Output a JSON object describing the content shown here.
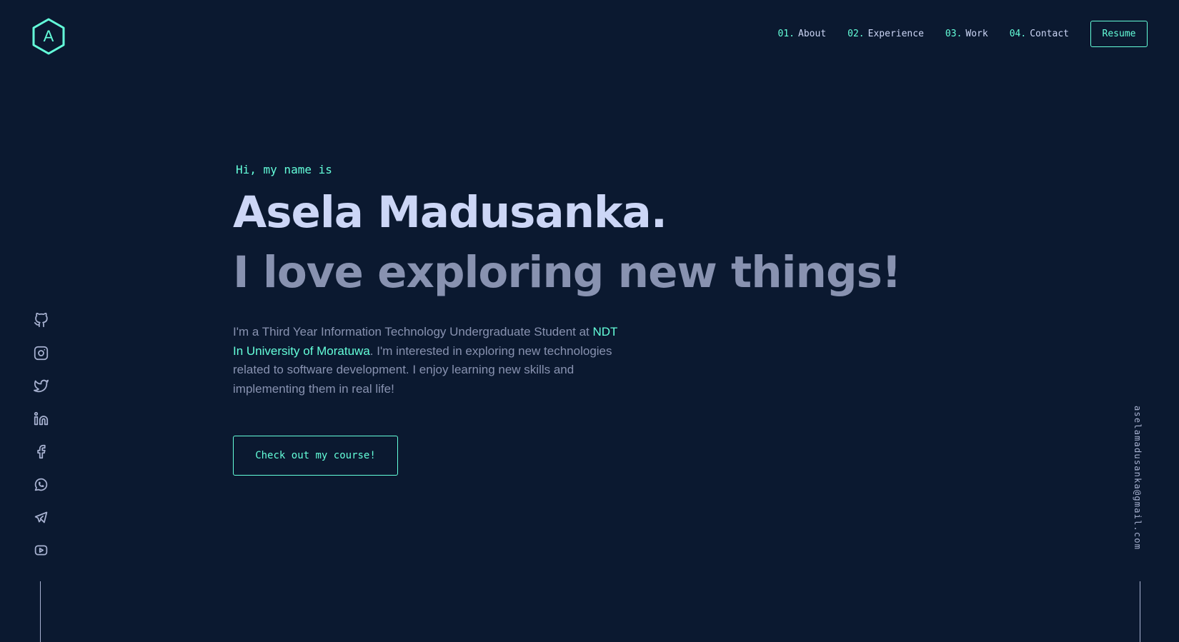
{
  "logo": {
    "letter": "A",
    "icon": "hexagon-logo-icon"
  },
  "nav": {
    "items": [
      {
        "num": "01.",
        "label": "About"
      },
      {
        "num": "02.",
        "label": "Experience"
      },
      {
        "num": "03.",
        "label": "Work"
      },
      {
        "num": "04.",
        "label": "Contact"
      }
    ],
    "resume_label": "Resume"
  },
  "hero": {
    "greeting": "Hi, my name is",
    "name": "Asela Madusanka.",
    "tagline": "I love exploring new things!",
    "bio_before": "I'm a Third Year Information Technology Undergraduate Student at ",
    "bio_link": "NDT In University of Moratuwa",
    "bio_after": ". I'm interested in exploring new technologies related to software development. I enjoy learning new skills and implementing them in real life!",
    "cta_label": "Check out my course!"
  },
  "social": [
    "github-icon",
    "instagram-icon",
    "twitter-icon",
    "linkedin-icon",
    "facebook-icon",
    "whatsapp-icon",
    "telegram-icon",
    "youtube-icon"
  ],
  "email": "aselamadusanka@gmail.com",
  "colors": {
    "background": "#0b1930",
    "accent": "#64ffda",
    "heading": "#ccd6f6",
    "text": "#8892b0"
  }
}
